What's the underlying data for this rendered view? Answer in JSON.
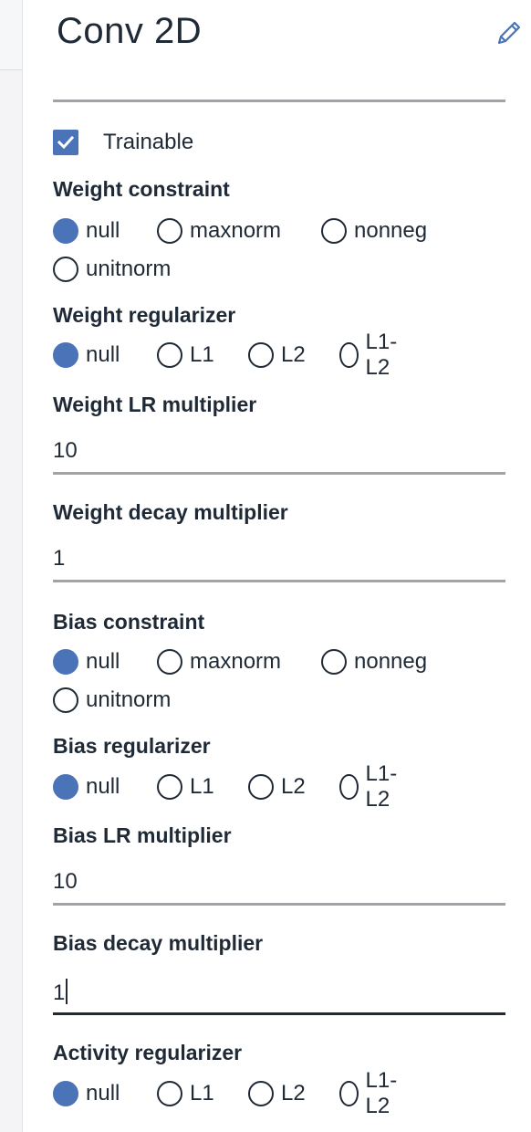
{
  "panel": {
    "title": "Conv 2D",
    "trainable_label": "Trainable",
    "trainable_checked": true
  },
  "weight_constraint": {
    "label": "Weight constraint",
    "options": [
      "null",
      "maxnorm",
      "nonneg",
      "unitnorm"
    ],
    "selected": "null"
  },
  "weight_regularizer": {
    "label": "Weight regularizer",
    "options": [
      "null",
      "L1",
      "L2",
      "L1-L2"
    ],
    "selected": "null"
  },
  "weight_lr_multiplier": {
    "label": "Weight LR multiplier",
    "value": "10"
  },
  "weight_decay_multiplier": {
    "label": "Weight decay multiplier",
    "value": "1"
  },
  "bias_constraint": {
    "label": "Bias constraint",
    "options": [
      "null",
      "maxnorm",
      "nonneg",
      "unitnorm"
    ],
    "selected": "null"
  },
  "bias_regularizer": {
    "label": "Bias regularizer",
    "options": [
      "null",
      "L1",
      "L2",
      "L1-L2"
    ],
    "selected": "null"
  },
  "bias_lr_multiplier": {
    "label": "Bias LR multiplier",
    "value": "10"
  },
  "bias_decay_multiplier": {
    "label": "Bias decay multiplier",
    "value": "1"
  },
  "activity_regularizer": {
    "label": "Activity regularizer",
    "options": [
      "null",
      "L1",
      "L2",
      "L1-L2"
    ],
    "selected": "null"
  },
  "colors": {
    "accent": "#4a73b8",
    "text": "#1f2a36",
    "divider": "#a0a4a8"
  },
  "icons": {
    "edit": "pencil-icon",
    "check": "checkmark-icon"
  }
}
